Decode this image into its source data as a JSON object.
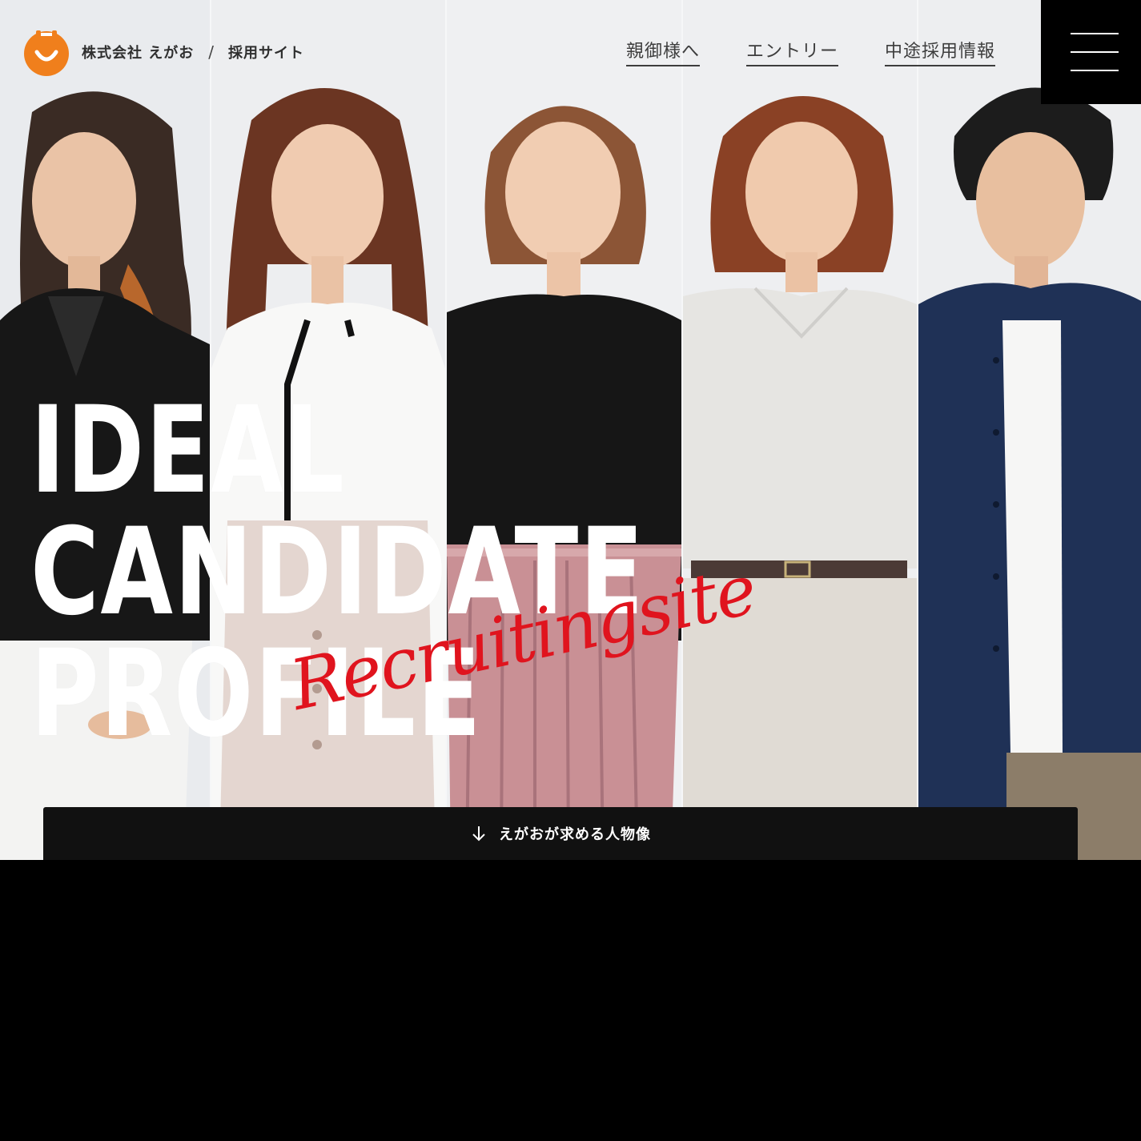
{
  "brand": {
    "company": "株式会社 えがお",
    "separator": "/",
    "site": "採用サイト",
    "logo_color": "#f07f1c"
  },
  "nav": {
    "items": [
      "親御様へ",
      "エントリー",
      "中途採用情報"
    ]
  },
  "menu": {
    "icon": "hamburger-menu-icon"
  },
  "hero": {
    "headline": [
      "IDEAL",
      "CANDIDATE",
      "PROFILE"
    ],
    "script": "Recruitingsite",
    "script_color": "#e0141e"
  },
  "cta": {
    "label": "えがおが求める人物像",
    "icon": "arrow-down-icon"
  }
}
